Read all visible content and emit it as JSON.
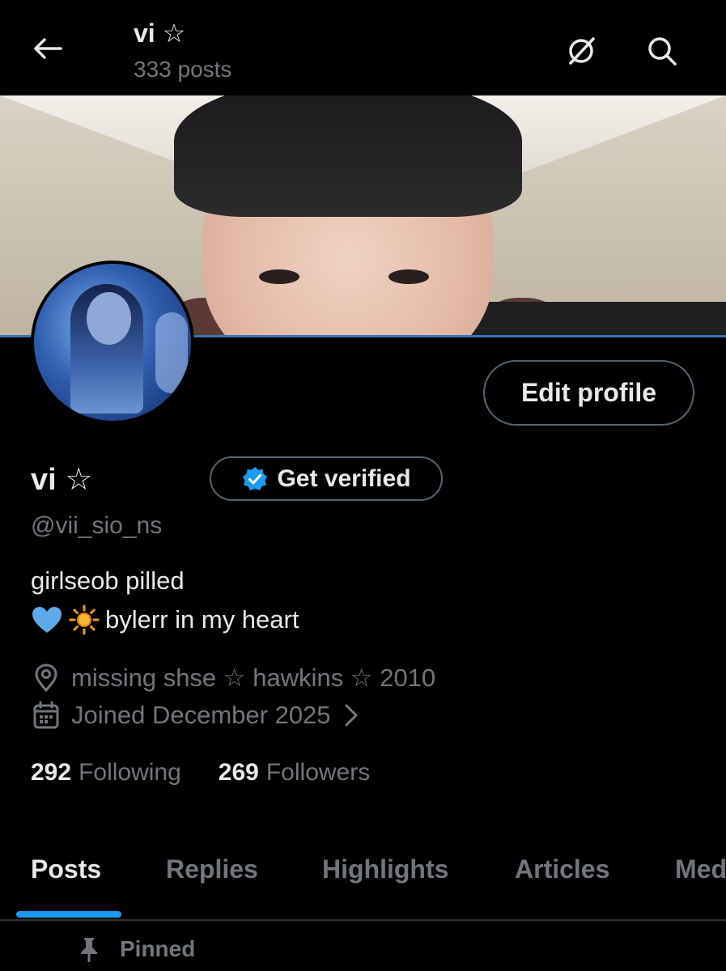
{
  "header": {
    "title": "vi ☆",
    "post_count": "333 posts",
    "icons": {
      "back": "arrow-left-icon",
      "grok": "grok-icon",
      "search": "search-icon"
    }
  },
  "profile": {
    "edit_label": "Edit profile",
    "name": "vi ☆",
    "verify_label": "Get verified",
    "handle": "@vii_sio_ns",
    "bio_line1": "girlseob pilled",
    "bio_line2_text": "bylerr in my heart",
    "location": "missing shse ☆ hawkins ☆ 2010",
    "joined": "Joined December 2025",
    "following_count": "292",
    "following_label": "Following",
    "followers_count": "269",
    "followers_label": "Followers"
  },
  "tabs": [
    {
      "label": "Posts",
      "active": true
    },
    {
      "label": "Replies",
      "active": false
    },
    {
      "label": "Highlights",
      "active": false
    },
    {
      "label": "Articles",
      "active": false
    },
    {
      "label": "Med",
      "active": false
    }
  ],
  "pinned_label": "Pinned",
  "colors": {
    "accent": "#1d9bf0",
    "muted": "#71767b",
    "text": "#e7e9ea",
    "border": "#536471"
  }
}
